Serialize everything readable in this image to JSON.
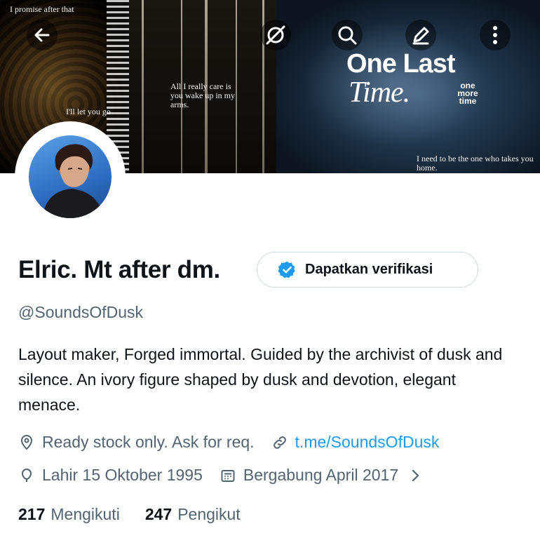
{
  "header": {
    "banner_texts": {
      "left_top": "I promise after that",
      "left_mid": "I'll let you go",
      "forest": "All I really care is you wake up in my arms.",
      "big_title": "One Last",
      "big_script": "Time.",
      "small_stack": "one more time",
      "bottom_right": "I need to be the one who takes you home."
    },
    "icons": [
      "back-icon",
      "mute-icon",
      "search-icon",
      "edit-icon",
      "more-icon"
    ]
  },
  "profile": {
    "name": "Elric. Mt after dm.",
    "verify_label": "Dapatkan verifikasi",
    "handle": "@SoundsOfDusk",
    "bio": "Layout maker, Forged immortal. Guided by the archivist of dusk and silence. An ivory figure shaped by dusk and devotion, elegant menace.",
    "location": "Ready stock only. Ask for req.",
    "link": "t.me/SoundsOfDusk",
    "birthday": "Lahir 15 Oktober 1995",
    "joined": "Bergabung April 2017",
    "following_count": "217",
    "following_label": "Mengikuti",
    "followers_count": "247",
    "followers_label": "Pengikut"
  },
  "colors": {
    "accent": "#1d9bf0",
    "secondary_text": "#536471",
    "primary_text": "#0f1419",
    "border": "#cfd9de"
  }
}
